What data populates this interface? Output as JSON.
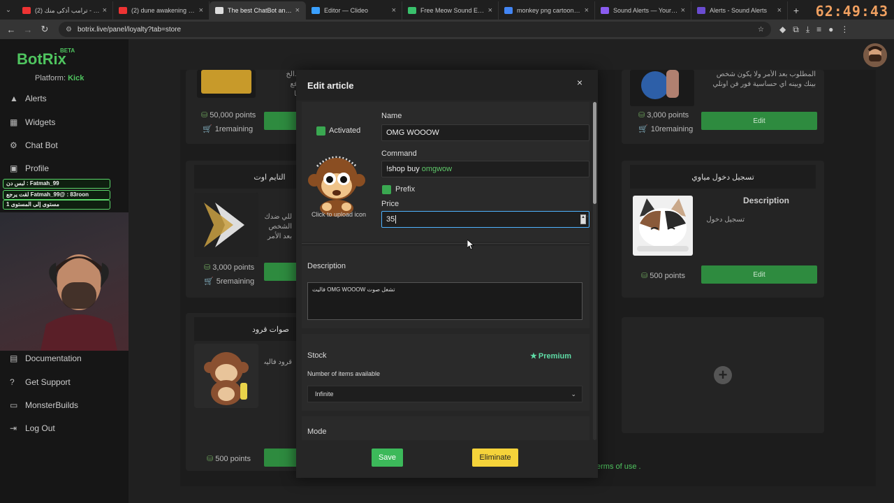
{
  "browser": {
    "tabs": [
      {
        "label": "(2) ترامب أذكى منك - Tube",
        "color": "#e33"
      },
      {
        "label": "(2) dune awakening game",
        "color": "#e33"
      },
      {
        "label": "The best ChatBot and Wi",
        "color": "#ddd"
      },
      {
        "label": "Editor — Clideo",
        "color": "#3aa0ff"
      },
      {
        "label": "Free Meow Sound Effects",
        "color": "#39c16c"
      },
      {
        "label": "monkey png cartoon - G",
        "color": "#4285f4"
      },
      {
        "label": "Sound Alerts — Your all-i",
        "color": "#8a5cf0"
      },
      {
        "label": "Alerts - Sound Alerts",
        "color": "#6a4cd0"
      }
    ],
    "url": "botrix.live/panel/loyalty?tab=store",
    "timer": "62:49:43"
  },
  "sidebar": {
    "brand": "BotRix",
    "beta": "BETA",
    "platform_label": "Platform:",
    "platform_value": "Kick",
    "nav_top": [
      {
        "label": "Alerts"
      },
      {
        "label": "Widgets"
      },
      {
        "label": "Chat Bot"
      },
      {
        "label": "Profile"
      }
    ],
    "chat_overlay": [
      "لبس دن : Fatmah_99",
      "لقت يرجع Fatmah_99@ : 83roon",
      "مستوى إلى المستوى 1"
    ],
    "nav_bottom": [
      {
        "label": "Documentation"
      },
      {
        "label": "Get Support"
      },
      {
        "label": "MonsterBuilds"
      },
      {
        "label": "Log Out"
      }
    ]
  },
  "store": {
    "cards": [
      {
        "desc": "...بازون ...الخ\nاحتمال ارفع\nبطاقة منها",
        "points": "50,000 points",
        "remaining": "1remaining"
      },
      {
        "title": "التايم اوت",
        "desc": "للي ضدك\nالشخص\nبعد الأمر",
        "points": "3,000 points",
        "remaining": "5remaining"
      },
      {
        "title": "صوات قرود",
        "desc": "قرود فاليت",
        "points": "500 points"
      },
      {
        "desc": "المطلوب بعد الأمر ولا يكون شخص\nبينك وبينه اي حساسية فور فن اونلي",
        "points": "3,000 points",
        "remaining": "10remaining",
        "edit": "Edit"
      },
      {
        "title": "تسجيل دخول مياوي",
        "desc_title": "Description",
        "desc": "تسجيل دخول",
        "points": "500 points",
        "edit": "Edit"
      }
    ],
    "terms": "erms of use ."
  },
  "modal": {
    "title": "Edit article",
    "close": "×",
    "activated_label": "Activated",
    "name_label": "Name",
    "name_value": "OMG WOOOW",
    "command_label": "Command",
    "command_prefix": "!shop buy",
    "command_arg": "omgwow",
    "prefix_label": "Prefix",
    "price_label": "Price",
    "price_value": "35",
    "upload_label": "Click to upload icon",
    "description_label": "Description",
    "description_value": "تشغل صوت OMG WOOOW فاليت",
    "stock_label": "Stock",
    "premium_label": "Premium",
    "items_label": "Number of items available",
    "items_value": "Infinite",
    "mode_label": "Mode",
    "save_label": "Save",
    "eliminate_label": "Eliminate"
  },
  "colors": {
    "accent": "#4fc45f",
    "save": "#3cb95a",
    "eliminate": "#f5d33a",
    "premium": "#5fdca6"
  }
}
